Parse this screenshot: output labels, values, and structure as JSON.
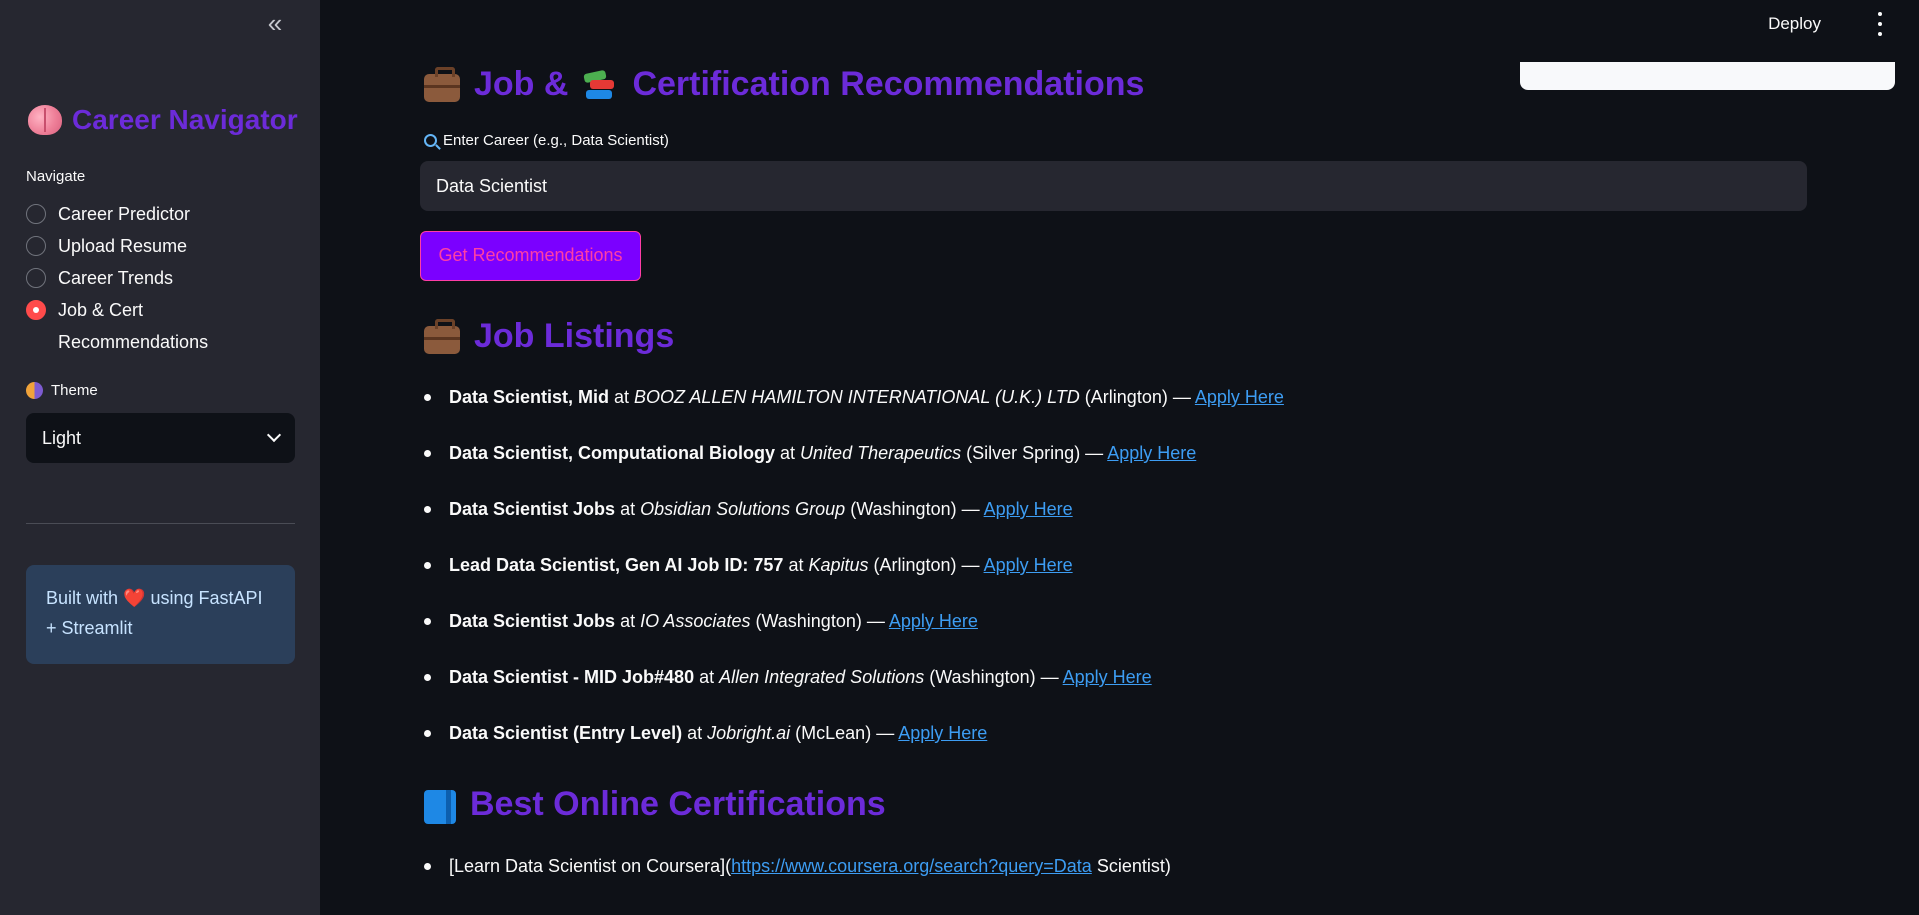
{
  "sidebar": {
    "collapse_icon": "double-chevron-left-icon",
    "brand": {
      "icon": "brain-icon",
      "title": "Career Navigator",
      "title_color": "#6c2bd9"
    },
    "nav_label": "Navigate",
    "nav_items": [
      {
        "label": "Career Predictor",
        "selected": false
      },
      {
        "label": "Upload Resume",
        "selected": false
      },
      {
        "label": "Career Trends",
        "selected": false
      },
      {
        "label": "Job & Cert Recommendations",
        "selected": true
      }
    ],
    "theme": {
      "icon": "half-moon-theme-icon",
      "label": "Theme",
      "selected": "Light"
    },
    "info": {
      "prefix": "Built with",
      "heart": "❤️",
      "suffix": "using FastAPI + Streamlit"
    }
  },
  "header": {
    "deploy_label": "Deploy",
    "menu_icon": "vertical-dots-icon"
  },
  "main": {
    "title": "Job & 📚 Certification Recommendations",
    "title_text_part1": "Job &",
    "title_text_part2": "Certification Recommendations",
    "input": {
      "label": "Enter Career (e.g., Data Scientist)",
      "value": "Data Scientist"
    },
    "button_label": "Get Recommendations",
    "jobs_heading": "Job Listings",
    "jobs": [
      {
        "title": "Data Scientist, Mid",
        "company": "BOOZ ALLEN HAMILTON INTERNATIONAL (U.K.) LTD",
        "location": "Arlington"
      },
      {
        "title": "Data Scientist, Computational Biology",
        "company": "United Therapeutics",
        "location": "Silver Spring"
      },
      {
        "title": "Data Scientist Jobs",
        "company": "Obsidian Solutions Group",
        "location": "Washington"
      },
      {
        "title": "Lead Data Scientist, Gen AI Job ID: 757",
        "company": "Kapitus",
        "location": "Arlington"
      },
      {
        "title": "Data Scientist Jobs",
        "company": "IO Associates",
        "location": "Washington"
      },
      {
        "title": "Data Scientist - MID Job#480",
        "company": "Allen Integrated Solutions",
        "location": "Washington"
      },
      {
        "title": "Data Scientist (Entry Level)",
        "company": "Jobright.ai",
        "location": "McLean"
      }
    ],
    "apply_label": "Apply Here",
    "certs_heading": "Best Online Certifications",
    "certs": [
      {
        "prefix": "[Learn Data Scientist on Coursera](",
        "link": "https://www.coursera.org/search?query=Data",
        "suffix": " Scientist)"
      }
    ]
  },
  "colors": {
    "heading": "#6c2bd9",
    "accent_radio": "#ff4b4b",
    "button_bg": "#7b00ff",
    "button_text": "#ff3ea5",
    "link": "#3d9df3",
    "info_bg": "#2b3f5a"
  }
}
